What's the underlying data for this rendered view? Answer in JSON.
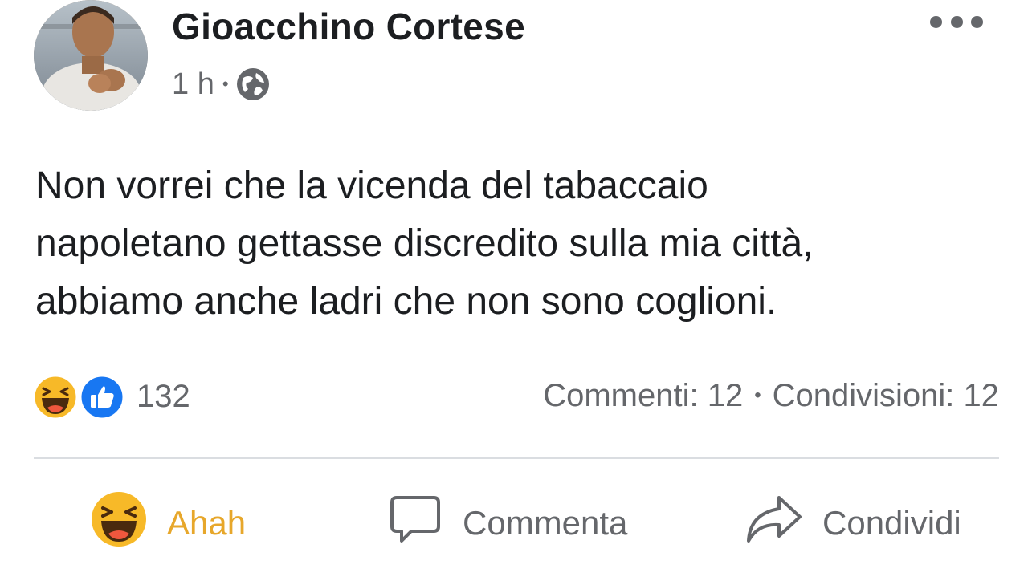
{
  "post": {
    "author_name": "Gioacchino Cortese",
    "timestamp": "1 h",
    "separator": "•",
    "audience_icon": "globe-icon",
    "more_icon": "more-options-icon",
    "text_lines": [
      "Non vorrei che la vicenda del tabaccaio",
      "napoletano gettasse discredito sulla mia città,",
      "abbiamo anche ladri che non sono coglioni."
    ]
  },
  "reactions": {
    "icons": [
      "haha-reaction-icon",
      "like-reaction-icon"
    ],
    "count": "132"
  },
  "stats": {
    "comments": "Commenti: 12",
    "separator": "•",
    "shares": "Condivisioni: 12"
  },
  "actions": {
    "react_label": "Ahah",
    "react_icon": "haha-emoji-icon",
    "react_color": "#e7a72b",
    "comment_label": "Commenta",
    "comment_icon": "comment-bubble-icon",
    "share_label": "Condividi",
    "share_icon": "share-arrow-icon"
  },
  "colors": {
    "text_primary": "#1c1e21",
    "text_secondary": "#65676b",
    "like_blue": "#1877f2",
    "haha_yellow": "#f7b928",
    "divider": "#dadde1"
  }
}
